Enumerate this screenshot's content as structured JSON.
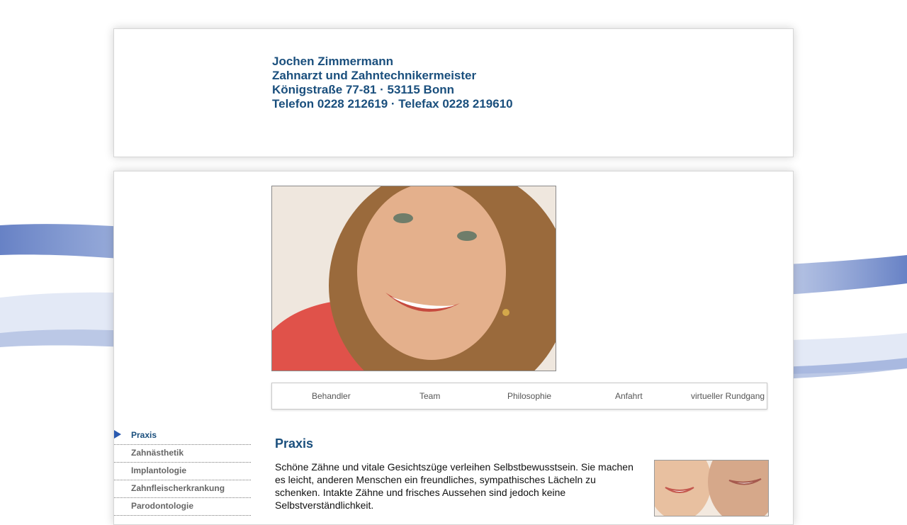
{
  "header": {
    "lines": [
      "Jochen Zimmermann",
      "Zahnarzt und Zahntechnikermeister",
      "Königstraße 77-81 · 53115 Bonn",
      "Telefon 0228 212619 · Telefax 0228 219610"
    ]
  },
  "top_nav": {
    "items": [
      "Behandler",
      "Team",
      "Philosophie",
      "Anfahrt",
      "virtueller Rundgang"
    ]
  },
  "side_nav": {
    "items": [
      {
        "label": "Praxis",
        "active": true
      },
      {
        "label": "Zahnästhetik",
        "active": false
      },
      {
        "label": "Implantologie",
        "active": false
      },
      {
        "label": "Zahnfleischerkrankung",
        "active": false
      },
      {
        "label": "Parodontologie",
        "active": false
      }
    ]
  },
  "content": {
    "title": "Praxis",
    "paragraph": "Schöne Zähne und vitale Gesichtszüge verleihen Selbstbewusstsein. Sie machen es leicht, anderen Menschen ein freundliches, sympathisches Lächeln zu schenken. Intakte Zähne und frisches Aussehen sind jedoch keine Selbstverständlichkeit."
  },
  "colors": {
    "accent": "#1a4f7d",
    "arrow": "#2a5ab0",
    "nav_text": "#555555"
  }
}
